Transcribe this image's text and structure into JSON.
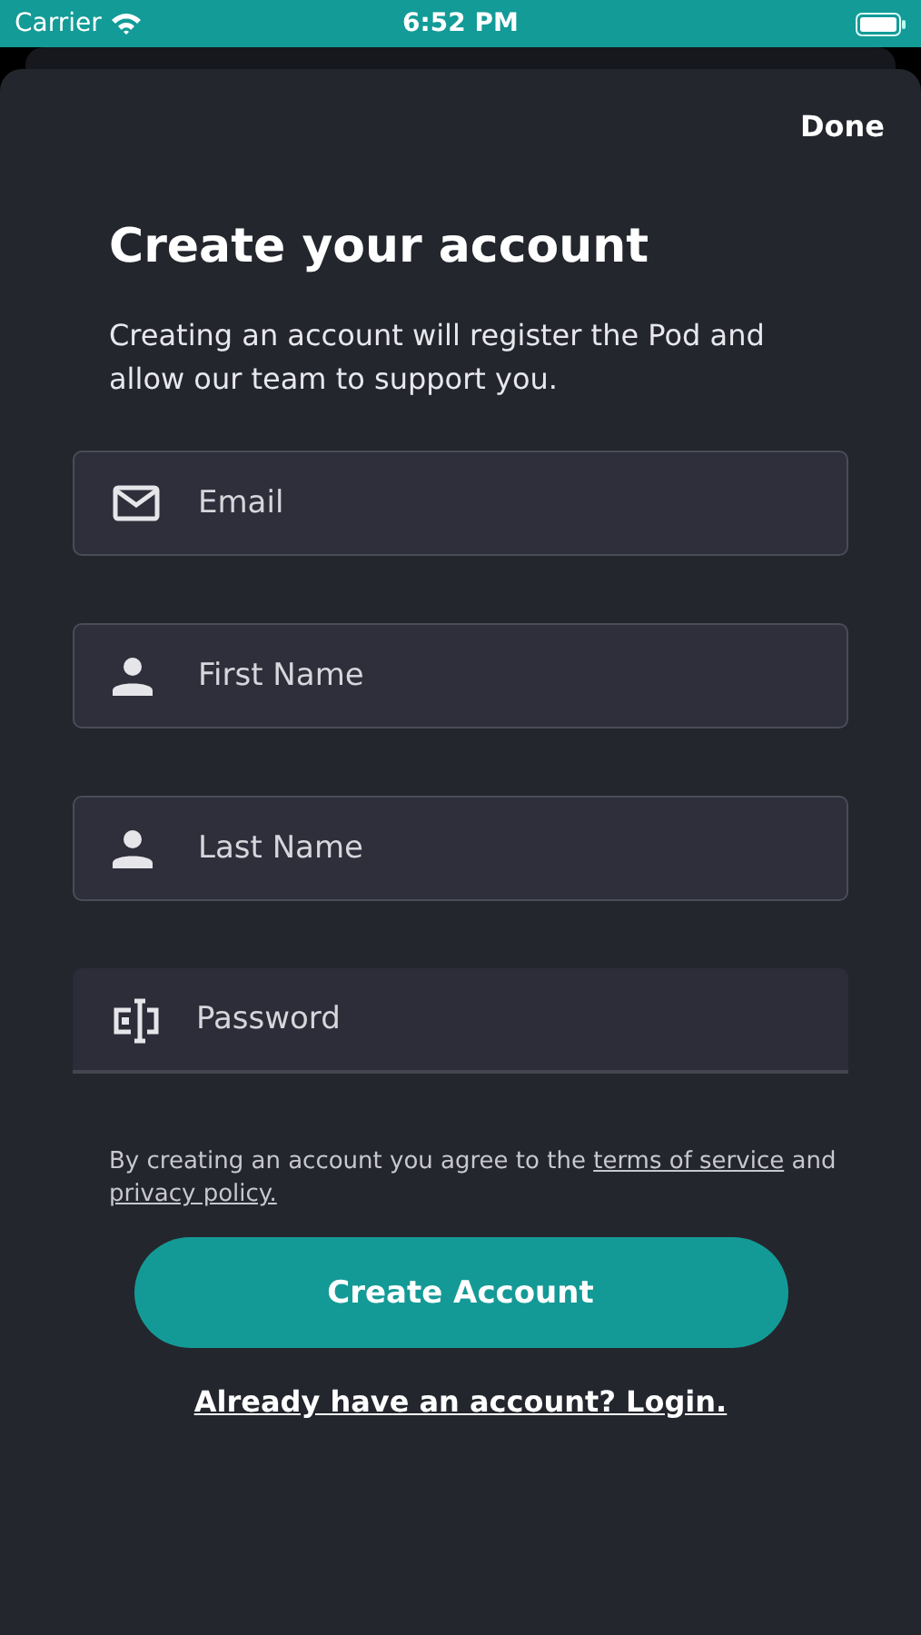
{
  "status_bar": {
    "carrier": "Carrier",
    "time": "6:52 PM"
  },
  "sheet": {
    "done": "Done",
    "title": "Create your account",
    "subtitle": "Creating an account will register the Pod and allow our team to support you.",
    "fields": [
      {
        "kind": "email",
        "placeholder": "Email",
        "focused": false
      },
      {
        "kind": "person",
        "placeholder": "First Name",
        "focused": false
      },
      {
        "kind": "person",
        "placeholder": "Last Name",
        "focused": false
      },
      {
        "kind": "password",
        "placeholder": "Password",
        "focused": true
      }
    ],
    "terms": [
      {
        "kind": "text",
        "text": "By creating an account you agree to the"
      },
      {
        "kind": "link",
        "text": "terms of service"
      },
      {
        "kind": "text",
        "text": "and"
      },
      {
        "kind": "link",
        "text": "privacy policy."
      }
    ],
    "create_button": "Create Account",
    "login_link": "Already have an account? Login."
  }
}
